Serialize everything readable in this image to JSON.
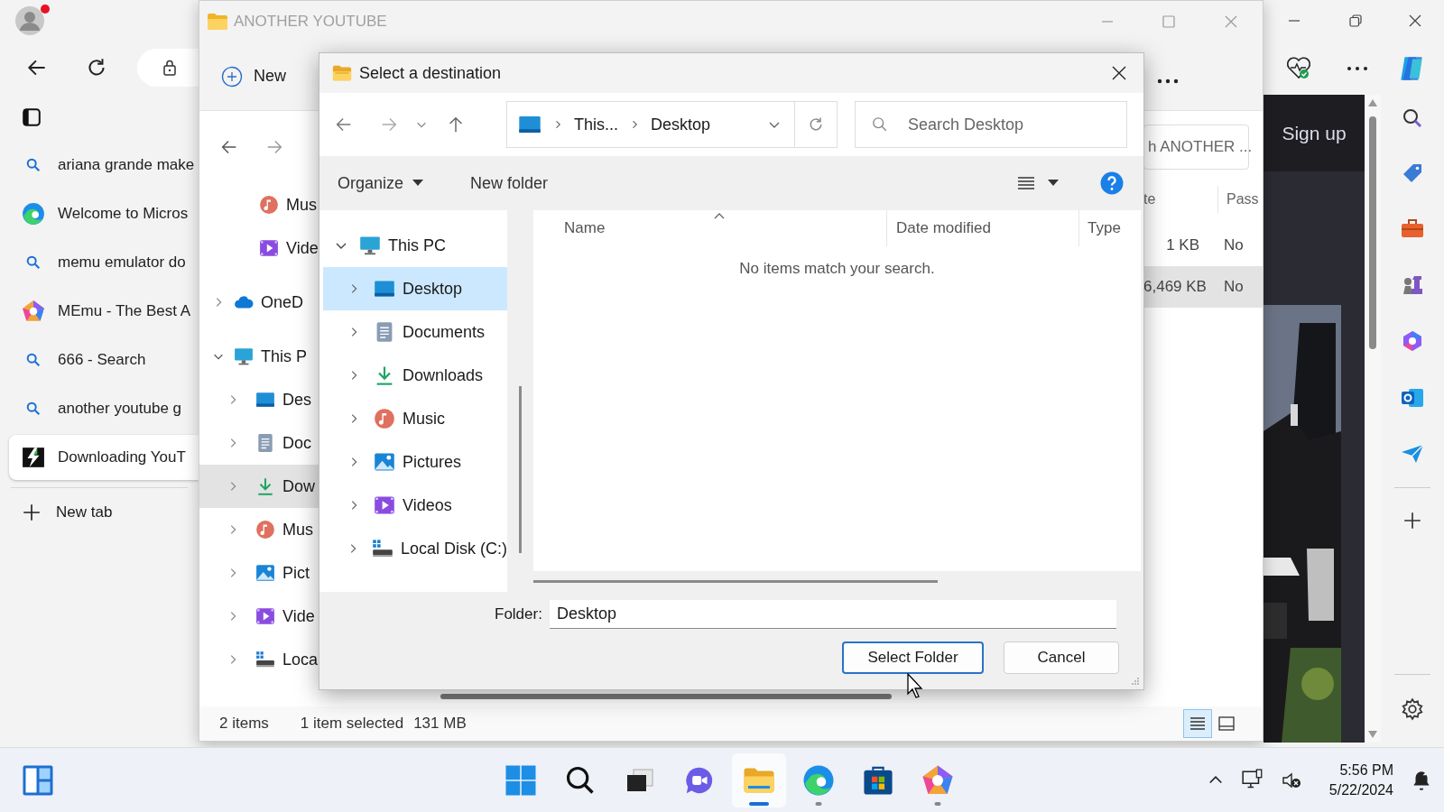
{
  "browser": {
    "tabs": [
      {
        "kind": "search",
        "title": "ariana grande make",
        "selected": false
      },
      {
        "kind": "edge",
        "title": "Welcome to Micros",
        "selected": false
      },
      {
        "kind": "search",
        "title": "memu emulator do",
        "selected": false
      },
      {
        "kind": "memu",
        "title": "MEmu - The Best A",
        "selected": false
      },
      {
        "kind": "search",
        "title": "666 - Search",
        "selected": false
      },
      {
        "kind": "search",
        "title": "another youtube g",
        "selected": false
      },
      {
        "kind": "download",
        "title": "Downloading YouT",
        "selected": true
      }
    ],
    "new_tab": "New tab",
    "page_link": "Sign up"
  },
  "explorer": {
    "title": "ANOTHER YOUTUBE",
    "new_button": "New",
    "quick_access": [
      {
        "kind": "music",
        "label": "Mus"
      },
      {
        "kind": "videos",
        "label": "Vide"
      }
    ],
    "tree": [
      {
        "kind": "onedrive",
        "label": "OneD",
        "expanded": false,
        "selected": false
      },
      {
        "kind": "pc",
        "label": "This P",
        "expanded": true,
        "selected": false,
        "children": [
          {
            "kind": "desktop",
            "label": "Des",
            "expanded": false,
            "selected": false
          },
          {
            "kind": "documents",
            "label": "Doc",
            "expanded": false,
            "selected": false
          },
          {
            "kind": "downloads",
            "label": "Dow",
            "expanded": false,
            "selected": true
          },
          {
            "kind": "music",
            "label": "Mus",
            "expanded": false,
            "selected": false
          },
          {
            "kind": "pictures",
            "label": "Pict",
            "expanded": false,
            "selected": false
          },
          {
            "kind": "videos",
            "label": "Vide",
            "expanded": false,
            "selected": false
          },
          {
            "kind": "disk",
            "label": "Loca",
            "expanded": false,
            "selected": false
          }
        ]
      }
    ],
    "search_placeholder": "h ANOTHER ...",
    "columns": [
      "te",
      "Pass"
    ],
    "rows": [
      {
        "cells": [
          "1 KB",
          "No"
        ],
        "selected": false
      },
      {
        "cells": [
          "6,469 KB",
          "No"
        ],
        "selected": true
      }
    ],
    "status": {
      "count": "2 items",
      "selection": "1 item selected",
      "size": "131 MB"
    },
    "views": [
      {
        "kind": "details",
        "selected": true
      },
      {
        "kind": "tiles",
        "selected": false
      }
    ]
  },
  "dialog": {
    "title": "Select a destination",
    "breadcrumbs": [
      "This...",
      "Desktop"
    ],
    "search_placeholder": "Search Desktop",
    "organize": "Organize",
    "new_folder": "New folder",
    "tree": [
      {
        "kind": "pc",
        "label": "This PC",
        "expanded": true,
        "selected": false,
        "children": [
          {
            "kind": "desktop",
            "label": "Desktop",
            "expanded": false,
            "selected": true
          },
          {
            "kind": "documents",
            "label": "Documents",
            "expanded": false,
            "selected": false
          },
          {
            "kind": "downloads",
            "label": "Downloads",
            "expanded": false,
            "selected": false
          },
          {
            "kind": "music",
            "label": "Music",
            "expanded": false,
            "selected": false
          },
          {
            "kind": "pictures",
            "label": "Pictures",
            "expanded": false,
            "selected": false
          },
          {
            "kind": "videos",
            "label": "Videos",
            "expanded": false,
            "selected": false
          },
          {
            "kind": "disk",
            "label": "Local Disk (C:)",
            "expanded": false,
            "selected": false
          }
        ]
      }
    ],
    "columns": [
      "Name",
      "Date modified",
      "Type"
    ],
    "empty_message": "No items match your search.",
    "folder_label": "Folder:",
    "folder_value": "Desktop",
    "buttons": [
      {
        "label": "Select Folder",
        "default": true
      },
      {
        "label": "Cancel",
        "default": false
      }
    ]
  },
  "taskbar": {
    "apps": [
      {
        "kind": "start",
        "running": false,
        "active": false
      },
      {
        "kind": "search",
        "running": false,
        "active": false
      },
      {
        "kind": "taskview",
        "running": false,
        "active": false
      },
      {
        "kind": "chat",
        "running": false,
        "active": false
      },
      {
        "kind": "explorer",
        "running": true,
        "active": true
      },
      {
        "kind": "edge",
        "running": true,
        "active": false
      },
      {
        "kind": "store",
        "running": false,
        "active": false
      },
      {
        "kind": "memu",
        "running": true,
        "active": false
      }
    ],
    "time": "5:56 PM",
    "date": "5/22/2024"
  }
}
